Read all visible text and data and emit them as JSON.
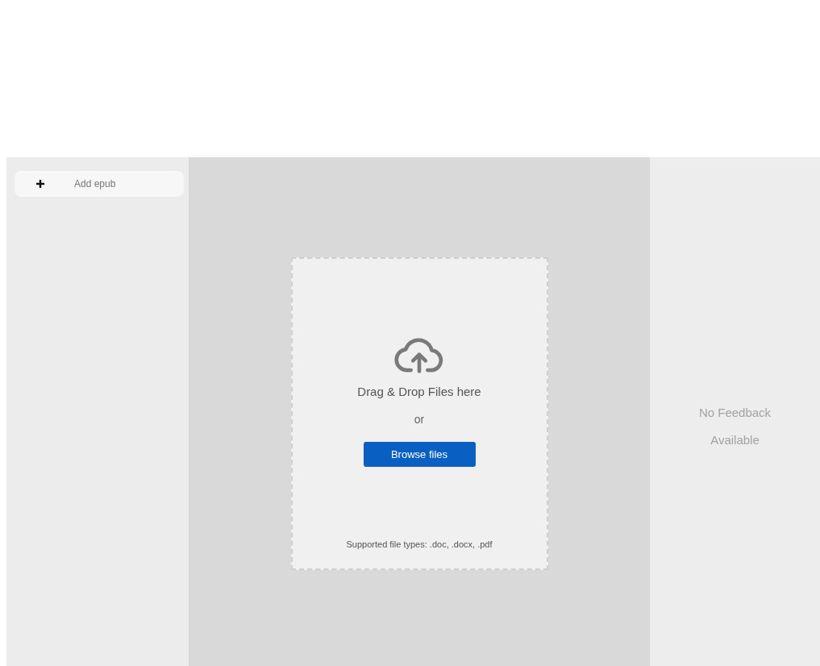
{
  "sidebar": {
    "add_button": {
      "label": "Add epub"
    }
  },
  "upload": {
    "title": "Drag & Drop Files here",
    "separator": "or",
    "button": "Browse files",
    "hint": "Supported file types: .doc, .docx, .pdf"
  },
  "feedback": {
    "message": "No Feedback Available"
  }
}
